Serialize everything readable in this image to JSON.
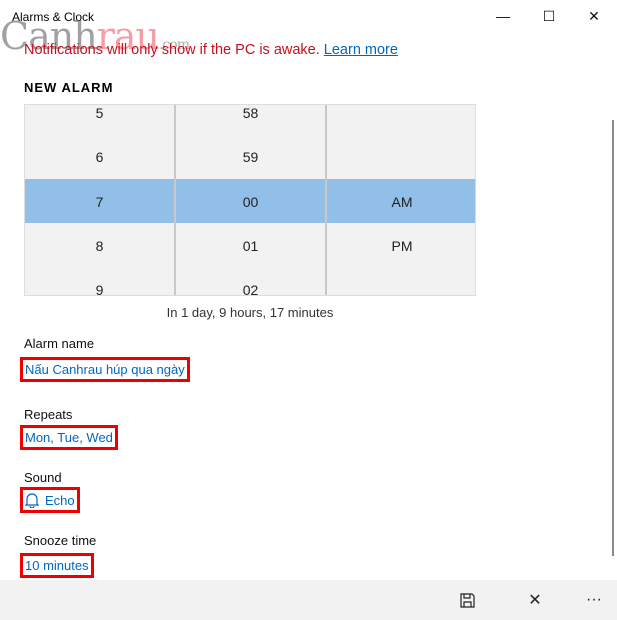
{
  "window": {
    "title": "Alarms & Clock",
    "minimize_icon": "minimize-icon",
    "maximize_icon": "maximize-icon",
    "close_icon": "close-icon"
  },
  "watermark": {
    "part1": "Canh",
    "part2": "rau",
    "part3": ".com"
  },
  "notice": {
    "text": "Notifications will only show if the PC is awake. ",
    "link": "Learn more"
  },
  "heading": "NEW ALARM",
  "picker": {
    "hours": [
      "5",
      "6",
      "7",
      "8",
      "9"
    ],
    "minutes": [
      "58",
      "59",
      "00",
      "01",
      "02"
    ],
    "periods": [
      "",
      "",
      "AM",
      "PM",
      ""
    ],
    "selected": {
      "hour": "7",
      "minute": "00",
      "period": "AM"
    },
    "selection_color": "#91bfe8"
  },
  "eta": "In 1 day, 9 hours, 17 minutes",
  "fields": {
    "name": {
      "label": "Alarm name",
      "value": "Nấu Canhrau húp qua ngày"
    },
    "repeats": {
      "label": "Repeats",
      "value": "Mon, Tue, Wed"
    },
    "sound": {
      "label": "Sound",
      "value": "Echo",
      "icon": "bell-icon"
    },
    "snooze": {
      "label": "Snooze time",
      "value": "10 minutes"
    }
  },
  "toolbar": {
    "save_icon": "save-icon",
    "close_icon": "close-icon",
    "more_icon": "more-icon"
  },
  "highlight_color": "#e00000"
}
